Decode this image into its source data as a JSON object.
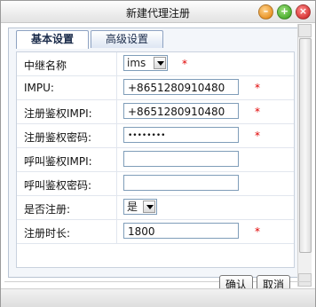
{
  "window": {
    "title": "新建代理注册"
  },
  "tabs": [
    {
      "label": "基本设置",
      "active": true
    },
    {
      "label": "高级设置",
      "active": false
    }
  ],
  "form": {
    "relay_name": {
      "label": "中继名称",
      "value": "ims",
      "required": "*"
    },
    "impu": {
      "label": "IMPU:",
      "value": "+8651280910480",
      "required": "*"
    },
    "reg_impi": {
      "label": "注册鉴权IMPI:",
      "value": "+8651280910480",
      "required": "*"
    },
    "reg_password": {
      "label": "注册鉴权密码:",
      "value": "••••••••",
      "required": "*"
    },
    "call_impi": {
      "label": "呼叫鉴权IMPI:",
      "value": ""
    },
    "call_password": {
      "label": "呼叫鉴权密码:",
      "value": ""
    },
    "do_register": {
      "label": "是否注册:",
      "value": "是"
    },
    "reg_duration": {
      "label": "注册时长:",
      "value": "1800",
      "required": "*"
    }
  },
  "buttons": {
    "ok": "确认",
    "cancel": "取消"
  }
}
